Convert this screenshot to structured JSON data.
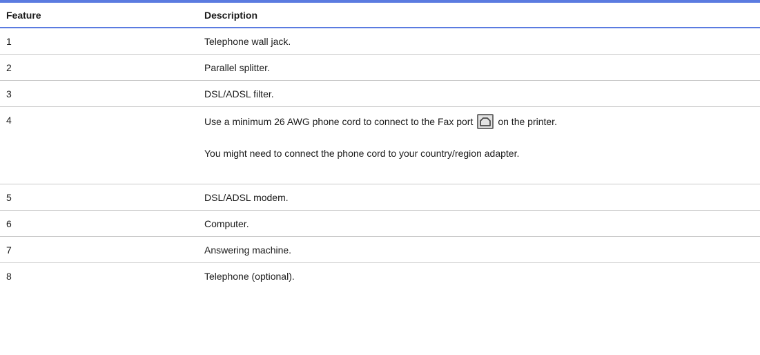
{
  "table": {
    "headers": {
      "feature": "Feature",
      "description": "Description"
    },
    "rows": [
      {
        "feature": "1",
        "description": "Telephone wall jack."
      },
      {
        "feature": "2",
        "description": "Parallel splitter."
      },
      {
        "feature": "3",
        "description": "DSL/ADSL filter."
      },
      {
        "feature": "4",
        "description_before_icon": "Use a minimum 26 AWG phone cord to connect to the Fax port",
        "icon": "fax-port-icon",
        "description_after_icon": "on the printer.",
        "description_note": "You might need to connect the phone cord to your country/region adapter."
      },
      {
        "feature": "5",
        "description": "DSL/ADSL modem."
      },
      {
        "feature": "6",
        "description": "Computer."
      },
      {
        "feature": "7",
        "description": "Answering machine."
      },
      {
        "feature": "8",
        "description": "Telephone (optional)."
      }
    ]
  },
  "colors": {
    "accent": "#5b7be0",
    "divider": "#c8c8c8",
    "text": "#1a1a1a"
  }
}
